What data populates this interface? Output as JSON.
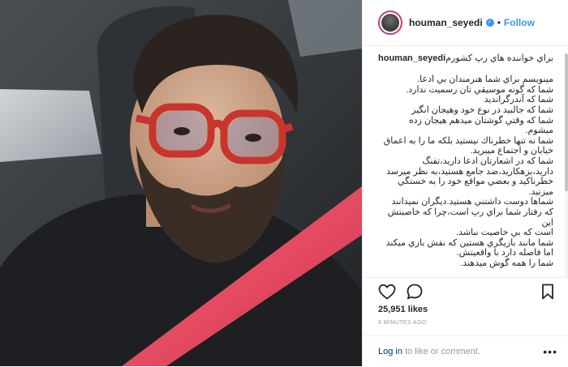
{
  "post": {
    "username": "houman_seyedi",
    "verified_mark": "✓",
    "dot": "•",
    "follow_label": "Follow",
    "likes": "25,951 likes",
    "time": "9 MINUTES AGO",
    "caption_title": "براي خواننده هاي رپ كشورم",
    "caption_lines": [
      "مينويسم براي شما هنرمندان بي ادعا.",
      "شما كه گونه موسيقي تان رسميت ندارد.",
      "شما كه آندرگرانديد",
      "شما كه جالبيد در نوع خود وهيجان انگيز",
      "شما كه وقتي گوشتان ميدهم هيجان زده",
      "ميشوم.",
      "شما نه تنها خطرناك نيستيد بلكه ما را به اعماق",
      "خيابان و اجتماع ميبريد.",
      "شما كه در اشعارتان ادعا داريد،تفنگ",
      "داريد،بزهكاريد،ضد جامع هستيد،به نظر ميرسد",
      "خطرناكيد و بعضي مواقع خود را به خستگي",
      "ميزنيد.",
      "شماها دوست داشتني هستيد.ديگران نميدانند",
      "كه رفتار شما براي رپ است،چرا كه خاصيتش اين",
      "است كه بي خاصيت نباشد.",
      "شما مانند بازيگري هستين كه نقش بازي ميكند",
      "اما فاصله دارد با واقعيتش.",
      "شما را همه گوش ميدهند."
    ]
  },
  "login": {
    "link_label": "Log in",
    "rest_label": "to like or comment.",
    "more_label": "•••"
  },
  "icons": {
    "heart": "heart-icon",
    "comment": "comment-icon",
    "save": "bookmark-icon",
    "more": "more-options-icon"
  },
  "colors": {
    "follow_blue": "#3897f0",
    "login_link": "#003569",
    "border": "#efefef",
    "seatbelt": "#e0435a",
    "glasses": "#c7352c"
  }
}
